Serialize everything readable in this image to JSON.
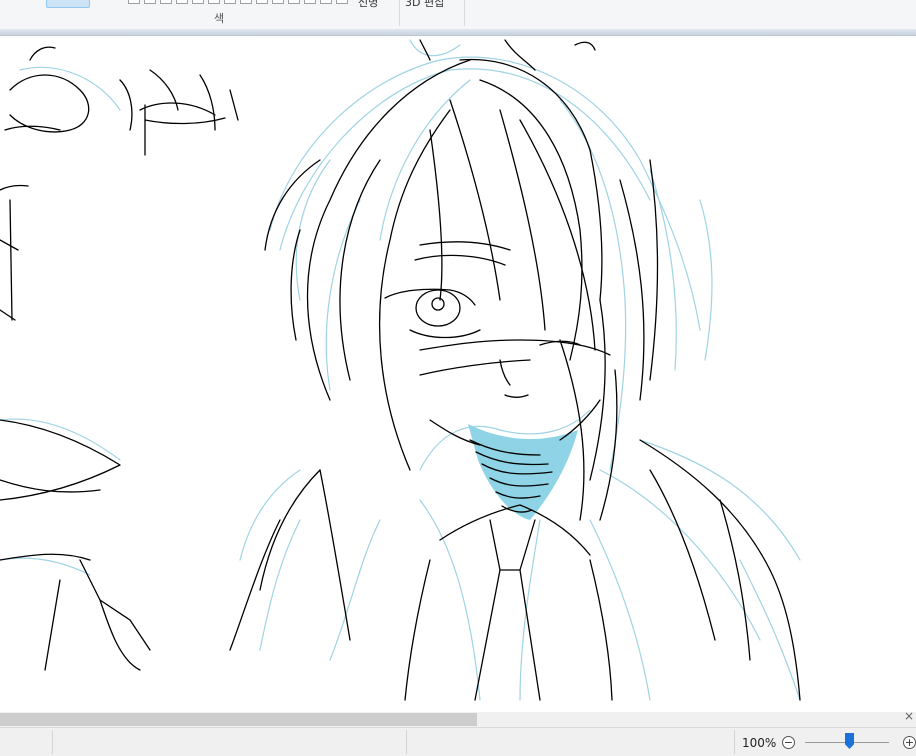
{
  "ribbon": {
    "group_label": "색",
    "cut_label_1": "선명",
    "cut_label_2": "3D 편집"
  },
  "canvas": {
    "line_color": "#000000",
    "sketch_color": "#9fd3e3",
    "fill_color": "#8fd4e6"
  },
  "statusbar": {
    "zoom_level": "100%",
    "zoom_out_symbol": "−",
    "zoom_in_symbol": "+",
    "zoom_slider_value": 0.5
  },
  "scrollbar": {
    "right_symbol": "×"
  },
  "colors": {
    "ribbon_bg": "#f5f6f7",
    "status_bg": "#f0f0f0",
    "accent": "#1a73d8"
  }
}
